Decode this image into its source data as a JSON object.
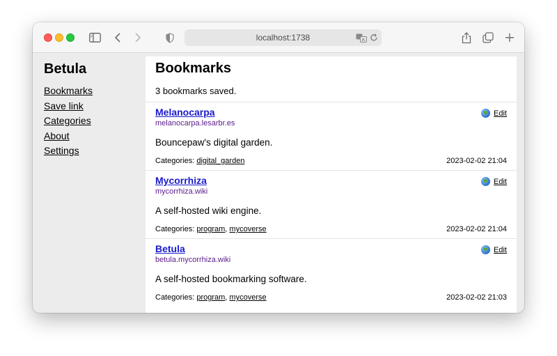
{
  "browser": {
    "address": "localhost:1738"
  },
  "sidebar": {
    "title": "Betula",
    "items": [
      {
        "label": "Bookmarks"
      },
      {
        "label": "Save link"
      },
      {
        "label": "Categories"
      },
      {
        "label": "About"
      },
      {
        "label": "Settings"
      }
    ]
  },
  "main": {
    "heading": "Bookmarks",
    "count_text": "3 bookmarks saved.",
    "categories_prefix": "Categories:",
    "edit_label": "Edit",
    "bookmarks": [
      {
        "title": "Melanocarpa",
        "url": "melanocarpa.lesarbr.es",
        "description": "Bouncepaw's digital garden.",
        "categories": [
          "digital_garden"
        ],
        "date": "2023-02-02 21:04"
      },
      {
        "title": "Mycorrhiza",
        "url": "mycorrhiza.wiki",
        "description": "A self-hosted wiki engine.",
        "categories": [
          "program",
          "mycoverse"
        ],
        "date": "2023-02-02 21:04"
      },
      {
        "title": "Betula",
        "url": "betula.mycorrhiza.wiki",
        "description": "A self-hosted bookmarking software.",
        "categories": [
          "program",
          "mycoverse"
        ],
        "date": "2023-02-02 21:03"
      }
    ]
  },
  "icons": {
    "sidebar_toggle": "sidebar-icon",
    "back": "chevron-left-icon",
    "forward": "chevron-right-icon",
    "privacy": "shield-icon",
    "translate": "translate-icon",
    "reload": "reload-icon",
    "share": "share-icon",
    "tabs": "tabs-overview-icon",
    "new_tab": "plus-icon",
    "site": "globe-icon"
  },
  "colors": {
    "link_title": "#1a1acc",
    "link_url": "#5a1a8a",
    "window_bg": "#ececec"
  }
}
